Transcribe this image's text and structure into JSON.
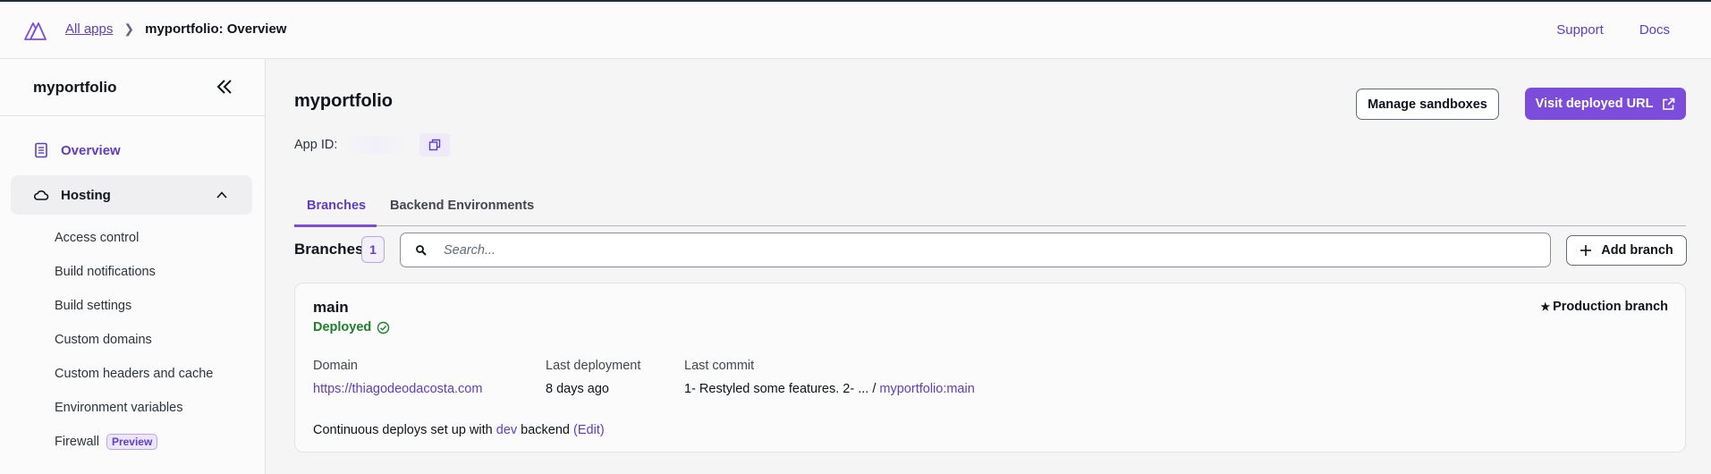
{
  "header": {
    "breadcrumb_link": "All apps",
    "breadcrumb_current": "myportfolio: Overview",
    "support": "Support",
    "docs": "Docs"
  },
  "sidebar": {
    "title": "myportfolio",
    "overview": "Overview",
    "hosting": "Hosting",
    "sub_items": [
      {
        "label": "Access control"
      },
      {
        "label": "Build notifications"
      },
      {
        "label": "Build settings"
      },
      {
        "label": "Custom domains"
      },
      {
        "label": "Custom headers and cache"
      },
      {
        "label": "Environment variables"
      },
      {
        "label": "Firewall",
        "badge": "Preview"
      }
    ]
  },
  "main": {
    "title": "myportfolio",
    "app_id_label": "App ID:",
    "manage_sandboxes": "Manage sandboxes",
    "visit_url": "Visit deployed URL",
    "tabs": [
      {
        "label": "Branches"
      },
      {
        "label": "Backend Environments"
      }
    ],
    "branches_label": "Branches",
    "branches_count": "1",
    "search_placeholder": "Search...",
    "add_branch": "Add branch",
    "branch": {
      "name": "main",
      "status": "Deployed",
      "production": "Production branch",
      "domain_label": "Domain",
      "domain": "https://thiagodeodacosta.com",
      "last_deployment_label": "Last deployment",
      "last_deployment": "8 days ago",
      "last_commit_label": "Last commit",
      "last_commit": "1- Restyled some features. 2- ... /",
      "commit_ref": "myportfolio:main",
      "cd_prefix": "Continuous deploys set up with",
      "cd_env": "dev",
      "cd_suffix": "backend",
      "cd_edit": "(Edit)"
    }
  },
  "colors": {
    "accent": "#7c4ddb",
    "link": "#5f3dc4",
    "success": "#1d7f2a"
  }
}
